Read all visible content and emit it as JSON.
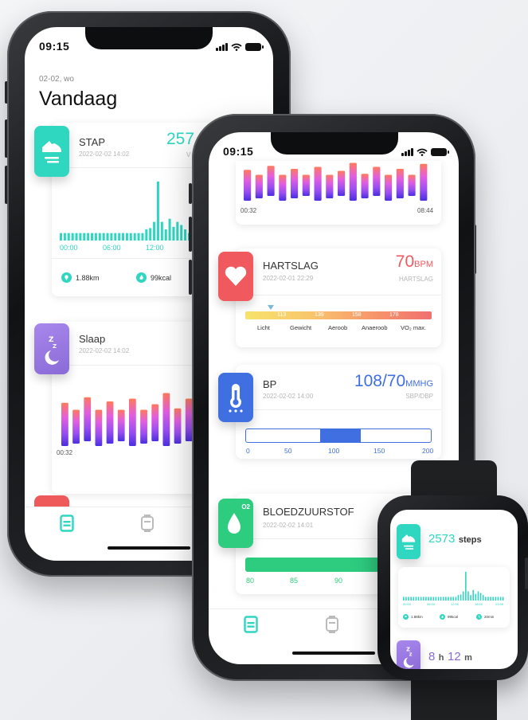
{
  "phone_left": {
    "status_time": "09:15",
    "header": {
      "date": "02-02, wo",
      "title": "Vandaag"
    },
    "step_card": {
      "title": "STAP",
      "date": "2022-02-02 14:02",
      "value": "257",
      "unit_fragment": "V",
      "x_labels": [
        "00:00",
        "06:00",
        "12:00"
      ],
      "stats": [
        {
          "icon": "location-pin-icon",
          "value": "1.88km"
        },
        {
          "icon": "flame-icon",
          "value": "99kcal"
        }
      ],
      "bar_levels": [
        0.12,
        0.12,
        0.12,
        0.12,
        0.12,
        0.12,
        0.12,
        0.12,
        0.12,
        0.12,
        0.12,
        0.12,
        0.12,
        0.12,
        0.12,
        0.12,
        0.12,
        0.12,
        0.12,
        0.12,
        0.12,
        0.12,
        0.18,
        0.2,
        0.3,
        0.95,
        0.3,
        0.18,
        0.35,
        0.22,
        0.3,
        0.25,
        0.18,
        0.12,
        0.12,
        0.12,
        0.12,
        0.12,
        0.12,
        0.12,
        0.12
      ]
    },
    "sleep_card": {
      "title": "Slaap",
      "date": "2022-02-02 14:02",
      "start_time": "00:32"
    },
    "tab_icons": [
      "report-tab-icon",
      "device-tab-icon"
    ],
    "colors": {
      "step": "#2fd6c0",
      "sleep": "#9b7de0",
      "next_card": "#ee5a5a"
    }
  },
  "phone_right": {
    "status_time": "09:15",
    "sleep_strip": {
      "start_time": "00:32",
      "end_time": "08:44"
    },
    "heart_card": {
      "title": "HARTSLAG",
      "date": "2022-02-01 22:29",
      "value": "70",
      "unit": "BPM",
      "sub": "HARTSLAG",
      "scale_ticks": [
        "113",
        "139",
        "158",
        "178"
      ],
      "zones": [
        "Licht",
        "Gewicht",
        "Aeroob",
        "Anaeroob",
        "VO₂ max."
      ]
    },
    "bp_card": {
      "title": "BP",
      "date": "2022-02-02 14:00",
      "value": "108/70",
      "unit": "MMHG",
      "sub": "SBP/DBP",
      "ticks": [
        "0",
        "50",
        "100",
        "150",
        "200"
      ],
      "range_fraction": [
        0.4,
        0.62
      ]
    },
    "oxygen_card": {
      "title": "BLOEDZUURSTOF",
      "date": "2022-02-02 14:01",
      "o2_label": "O2",
      "ticks": [
        "80",
        "85",
        "90"
      ]
    },
    "tab_icons": [
      "report-tab-icon",
      "device-tab-icon"
    ],
    "colors": {
      "heart": "#f05a5f",
      "bp": "#3f6fe0",
      "oxygen": "#2ecc7f"
    }
  },
  "watch": {
    "steps_value": "2573",
    "steps_unit": "steps",
    "x_labels": [
      "00:00",
      "06:00",
      "12:00",
      "18:00",
      "23:59"
    ],
    "stats": [
      {
        "icon": "location-pin-icon",
        "value": "1.88km"
      },
      {
        "icon": "flame-icon",
        "value": "99kcal"
      },
      {
        "icon": "clock-icon",
        "value": "20min"
      }
    ],
    "sleep_h": "8",
    "sleep_h_unit": "h",
    "sleep_m": "12",
    "sleep_m_unit": "m"
  }
}
